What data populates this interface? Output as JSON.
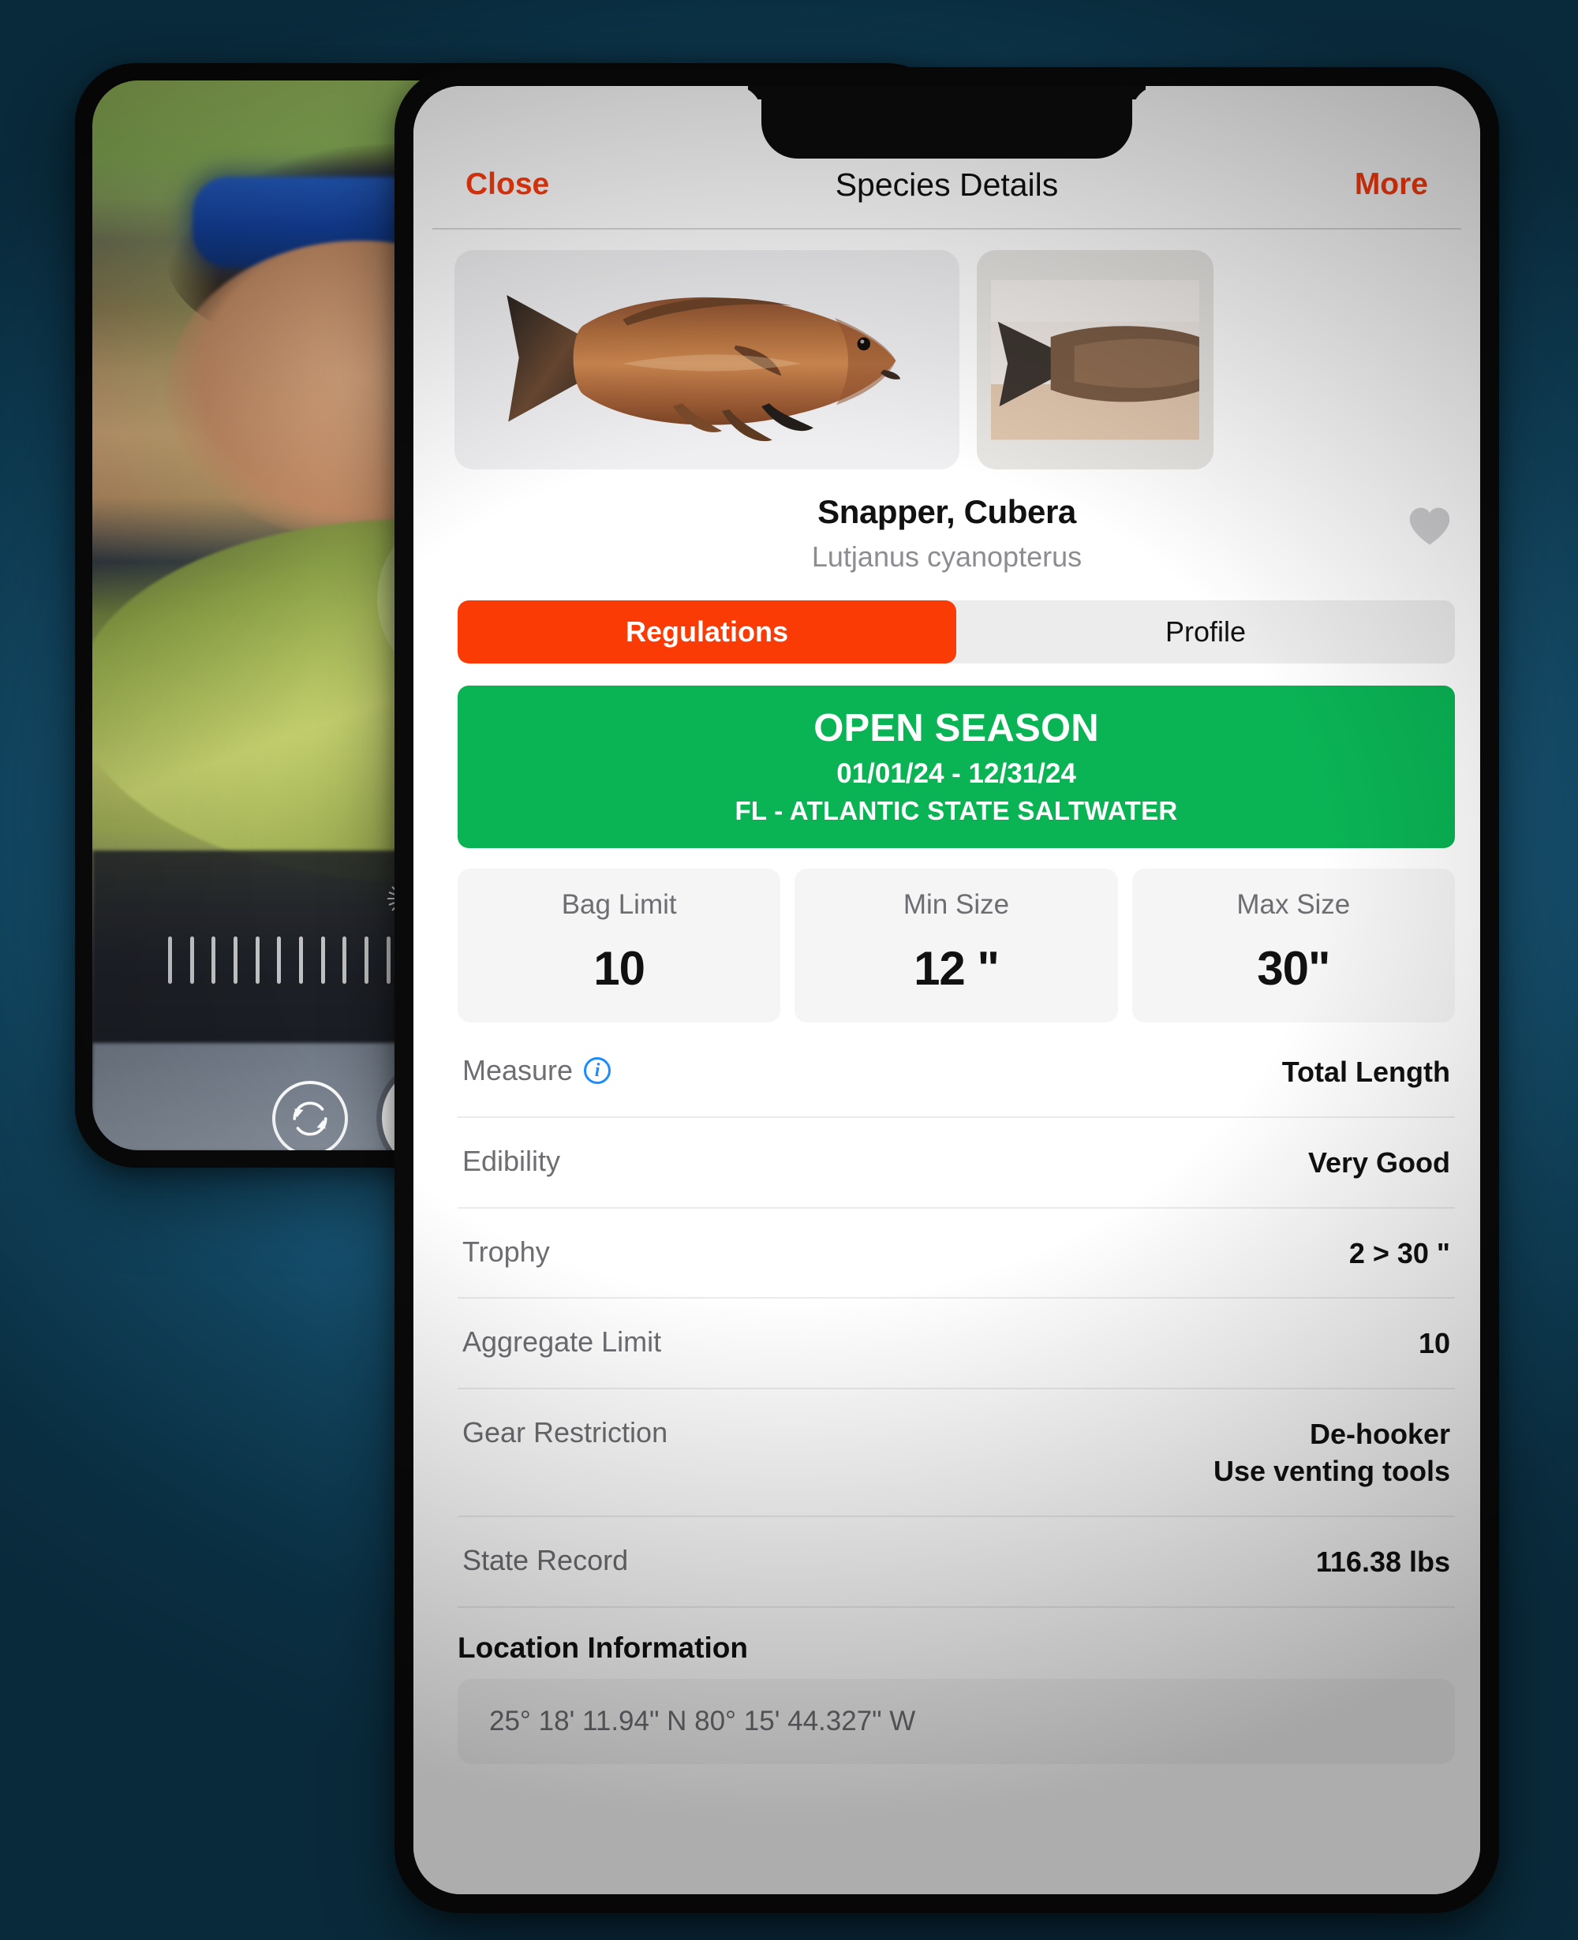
{
  "theme": {
    "accent": "#ff3b0f",
    "accent_segment": "#fb3b06",
    "open_season_green": "#0ab455",
    "info_blue": "#1a8cff",
    "background_teal": "#1b5c7e"
  },
  "left_phone": {
    "name": "camera-capture-screen",
    "controls": {
      "exposure_icon": "sun-icon",
      "exposure_slider": "exposure-slider",
      "rotate_camera_icon": "rotate-camera-icon",
      "shutter_button": "shutter-button"
    }
  },
  "nav": {
    "close_label": "Close",
    "title": "Species Details",
    "more_label": "More"
  },
  "gallery": {
    "images": [
      {
        "alt": "Cubera snapper specimen photo",
        "name": "species-photo-primary"
      },
      {
        "alt": "Cubera snapper held by angler",
        "name": "species-photo-secondary"
      }
    ]
  },
  "species": {
    "common_name": "Snapper, Cubera",
    "scientific_name": "Lutjanus cyanopterus",
    "favorite_icon": "heart-icon",
    "favorited": false
  },
  "tabs": [
    {
      "label": "Regulations",
      "active": true
    },
    {
      "label": "Profile",
      "active": false
    }
  ],
  "season": {
    "status": "OPEN SEASON",
    "dates": "01/01/24 - 12/31/24",
    "region": "FL - ATLANTIC STATE SALTWATER"
  },
  "stats": [
    {
      "label": "Bag Limit",
      "value": "10"
    },
    {
      "label": "Min Size",
      "value": "12 \""
    },
    {
      "label": "Max Size",
      "value": "30\""
    }
  ],
  "details": [
    {
      "label": "Measure",
      "value": "Total Length",
      "has_info_icon": true
    },
    {
      "label": "Edibility",
      "value": "Very Good",
      "has_info_icon": false
    },
    {
      "label": "Trophy",
      "value": "2 > 30 \"",
      "has_info_icon": false
    },
    {
      "label": "Aggregate Limit",
      "value": "10",
      "has_info_icon": false
    },
    {
      "label": "Gear Restriction",
      "value": "De-hooker\nUse venting tools",
      "value_line1": "De-hooker",
      "value_line2": "Use venting tools",
      "has_info_icon": false
    },
    {
      "label": "State Record",
      "value": "116.38 lbs",
      "has_info_icon": false
    }
  ],
  "location": {
    "section_title": "Location Information",
    "coordinates": "25° 18' 11.94\" N  80° 15' 44.327\" W"
  }
}
